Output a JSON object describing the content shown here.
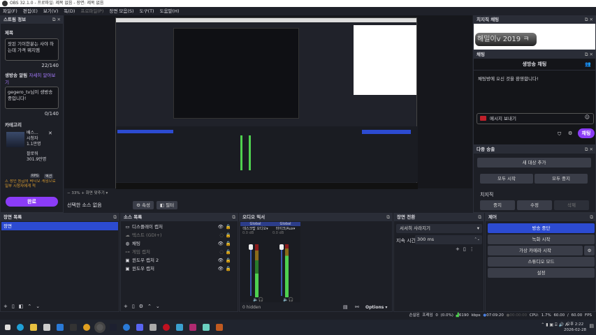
{
  "window": {
    "title": "OBS 32.1.0 - 프로파일: 제목 없음 - 장면: 제목 없음"
  },
  "menu": [
    "파일(F)",
    "편집(E)",
    "보기(V)",
    "독(D)",
    "프로파일(P)",
    "장면 모음(S)",
    "도구(T)",
    "도움말(H)"
  ],
  "stream_info": {
    "title": "스트림 정보",
    "title_label": "제목",
    "title_value": "잣된 기이한분는 사야 하는데 가격 웨지엠",
    "title_count": "22/140",
    "notice_label": "생방송 알림",
    "notice_link": "자세히 알아보기",
    "notice_value": "gegero_tv님이 생방송 중입니다!",
    "notice_count": "0/140",
    "category_label": "카테고리",
    "game_name": "배스...",
    "viewers_label": "시청자",
    "viewers": "1.1만명",
    "followers_label": "팔로워",
    "followers": "301.9만명",
    "tags": [
      "RPG",
      "액션"
    ],
    "warning": "성인 등급의 비디오 게임으로 일부 시청자에게 적",
    "done": "완료"
  },
  "preview": {
    "zoom": "33%",
    "fit": "화면 맞추기",
    "no_source": "선택한 소스 없음",
    "props": "속성",
    "filters": "필터"
  },
  "chzzk_chat": {
    "title": "치지직 채팅",
    "badge": "해밀이v 2019 ㅋ"
  },
  "chat": {
    "title": "채팅",
    "header": "생방송 채팅",
    "welcome": "채팅방에 오신 것을 환영합니다!",
    "placeholder": "메시지 보내기",
    "send": "채팅"
  },
  "multistream": {
    "title": "다중 송출",
    "add": "새 대상 추가",
    "start_all": "모두 시작",
    "stop_all": "모두 중지",
    "chzzk": "치지직",
    "stop": "중지",
    "edit": "수정",
    "delete": "삭제"
  },
  "scenes": {
    "title": "장면 목록",
    "items": [
      "장면"
    ]
  },
  "sources": {
    "title": "소스 목록",
    "items": [
      "디스플레이 캡처",
      "텍스트 (GDI+)",
      "채팅",
      "게임 캡처",
      "윈도우 캡처 2",
      "윈도우 캡처"
    ]
  },
  "mixer": {
    "title": "오디오 믹서",
    "channels": [
      {
        "tag": "Global",
        "name": "데스크탑 오디오",
        "db": "0.0 dB"
      },
      {
        "tag": "Global",
        "name": "마이크/Aux",
        "db": "0.0 dB"
      }
    ],
    "hidden": "0 hidden",
    "options": "Options"
  },
  "transitions": {
    "title": "장면 전환",
    "selected": "서서히 사라지기",
    "duration_label": "지속 시간",
    "duration": "300 ms"
  },
  "controls": {
    "title": "제어",
    "buttons": [
      "방송 중단",
      "녹화 시작",
      "가상 카메라 시작",
      "스튜디오 모드",
      "설정"
    ]
  },
  "status": {
    "dropped": "손실된 프레임 0 (0.0%)",
    "bitrate": "6190 kbps",
    "stream_time": "07:09:20",
    "rec_time": "00:00:00",
    "cpu": "CPU: 1.7%",
    "fps": "60.00 / 60.00 FPS"
  },
  "taskbar": {
    "time": "오후 2:22",
    "date": "2026-02-28",
    "ime": "A"
  },
  "colors": {
    "accent": "#8b3cf7",
    "blue": "#2c4bd1"
  }
}
